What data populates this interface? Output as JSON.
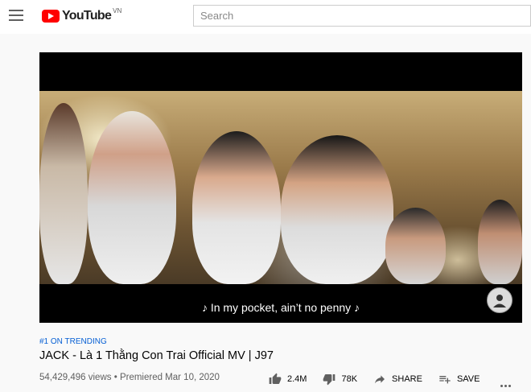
{
  "header": {
    "logo_text": "YouTube",
    "country_code": "VN",
    "search_placeholder": "Search"
  },
  "player": {
    "subtitle": "♪ In my pocket, ain’t no penny ♪"
  },
  "video": {
    "trending_label": "#1 ON TRENDING",
    "title": "JACK - Là 1 Thằng Con Trai Official MV | J97",
    "views": "54,429,496 views",
    "premiered": "• Premiered Mar 10, 2020",
    "likes": "2.4M",
    "dislikes": "78K",
    "share_label": "SHARE",
    "save_label": "SAVE"
  },
  "icons": {
    "menu": "hamburger-menu-icon",
    "like": "thumbs-up-icon",
    "dislike": "thumbs-down-icon",
    "share": "share-arrow-icon",
    "save": "playlist-add-icon",
    "more": "more-horizontal-icon"
  },
  "colors": {
    "brand_red": "#ff0000",
    "link_blue": "#065fd4",
    "background": "#f9f9f9"
  }
}
